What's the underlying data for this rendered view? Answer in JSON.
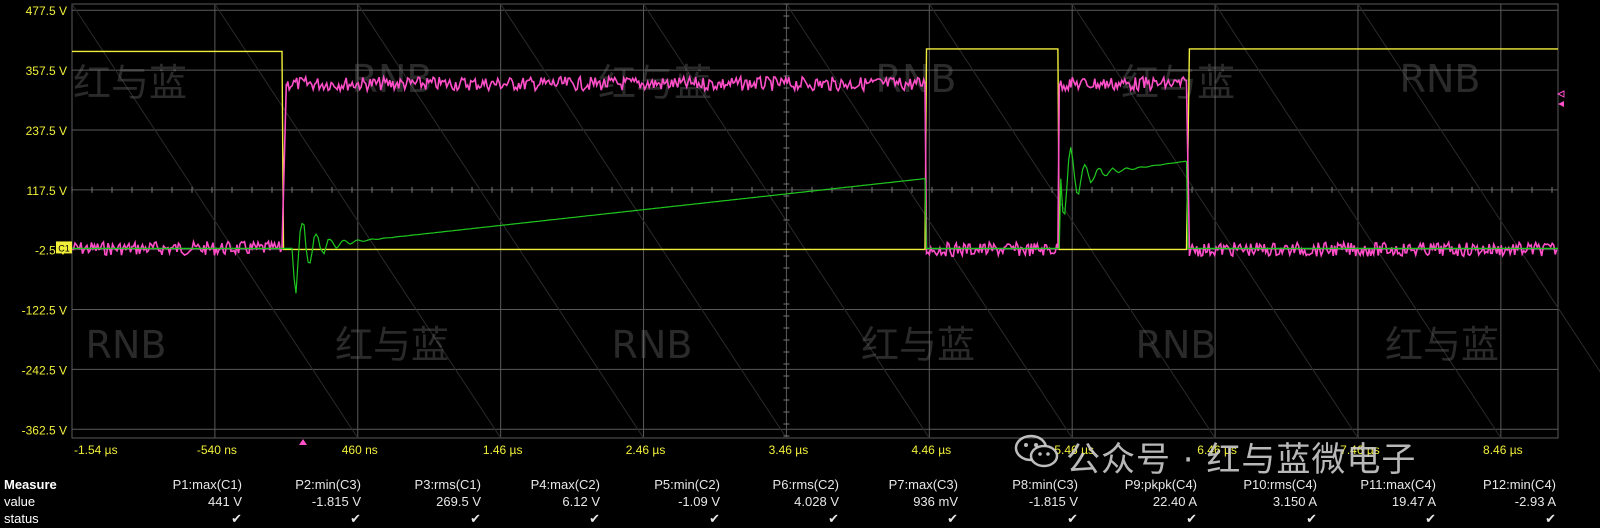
{
  "chart_data": {
    "type": "line",
    "y_tick_labels": [
      "477.5 V",
      "357.5 V",
      "237.5 V",
      "117.5 V",
      "-2.5 V",
      "-122.5 V",
      "-242.5 V",
      "-362.5 V"
    ],
    "x_tick_labels": [
      "-1.54 µs",
      "-540 ns",
      "460 ns",
      "1.46 µs",
      "2.46 µs",
      "3.46 µs",
      "4.46 µs",
      "5.46 µs",
      "6.46 µs",
      "7.46 µs",
      "8.46 µs"
    ],
    "x_range_us": [
      -1.54,
      8.86
    ],
    "y_range_V": [
      -380,
      490
    ],
    "channel_marker": "C1",
    "grid": true,
    "colors": {
      "yellow_trace": "#f2ef3a",
      "pink_trace": "#ff4fc9",
      "green_trace": "#1ec81e",
      "grid": "#5a5a5a",
      "tick_label": "#f2ef3a"
    },
    "series": [
      {
        "color": "#f2ef3a",
        "x": [
          -1.54,
          -0.07,
          -0.06,
          0.02,
          4.43,
          4.44,
          4.46,
          5.36,
          5.37,
          5.45,
          6.26,
          6.28,
          6.3,
          8.86
        ],
        "y": [
          395,
          395,
          -2,
          -2,
          -2,
          400,
          400,
          400,
          -2,
          -2,
          -2,
          400,
          400,
          400
        ]
      },
      {
        "color": "#ff4fc9",
        "x": [
          -1.54,
          -0.07,
          -0.04,
          -0.02,
          4.43,
          4.44,
          4.46,
          5.36,
          5.37,
          5.45,
          6.26,
          6.28,
          6.3,
          8.86
        ],
        "y": [
          0,
          0,
          330,
          330,
          330,
          -2,
          -2,
          -2,
          330,
          330,
          330,
          -2,
          -2,
          -2
        ]
      },
      {
        "color": "#1ec81e",
        "x": [
          -1.54,
          -0.07,
          0.0,
          4.43,
          4.44,
          5.37,
          5.38,
          6.26,
          6.27,
          8.86
        ],
        "y": [
          0,
          0,
          0,
          140,
          0,
          0,
          140,
          175,
          0,
          0
        ]
      }
    ]
  },
  "watermarks": {
    "latin": "RNB",
    "cjk": "红与蓝"
  },
  "wechat_source": "公众号 · 红与蓝微电子",
  "measure": {
    "header_label": "Measure",
    "value_label": "value",
    "status_label": "status",
    "status_symbol": "✔",
    "items": [
      {
        "name": "P1:max(C1)",
        "value": "441 V"
      },
      {
        "name": "P2:min(C3)",
        "value": "-1.815 V"
      },
      {
        "name": "P3:rms(C1)",
        "value": "269.5 V"
      },
      {
        "name": "P4:max(C2)",
        "value": "6.12 V"
      },
      {
        "name": "P5:min(C2)",
        "value": "-1.09 V"
      },
      {
        "name": "P6:rms(C2)",
        "value": "4.028 V"
      },
      {
        "name": "P7:max(C3)",
        "value": "936 mV"
      },
      {
        "name": "P8:min(C3)",
        "value": "-1.815 V"
      },
      {
        "name": "P9:pkpk(C4)",
        "value": "22.40 A"
      },
      {
        "name": "P10:rms(C4)",
        "value": "3.150 A"
      },
      {
        "name": "P11:max(C4)",
        "value": "19.47 A"
      },
      {
        "name": "P12:min(C4)",
        "value": "-2.93 A"
      }
    ]
  }
}
